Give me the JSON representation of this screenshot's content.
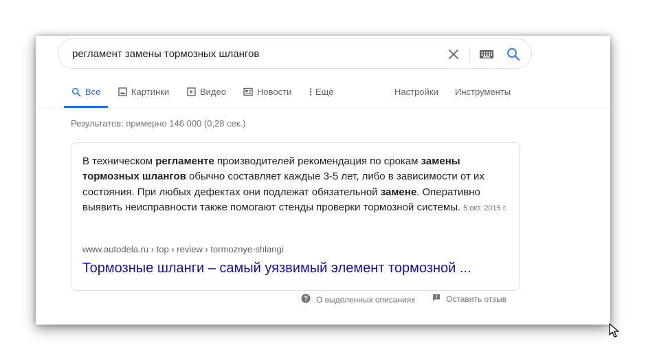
{
  "search": {
    "query": "регламент замены тормозных шлангов"
  },
  "tabs": [
    {
      "label": "Все",
      "icon": "search-icon",
      "active": true
    },
    {
      "label": "Картинки",
      "icon": "image-icon"
    },
    {
      "label": "Видео",
      "icon": "video-icon"
    },
    {
      "label": "Новости",
      "icon": "news-icon"
    },
    {
      "label": "Ещё",
      "icon": "more-vert-icon"
    }
  ],
  "tools": {
    "settings": "Настройки",
    "tools": "Инструменты"
  },
  "stats": "Результатов: примерно 146 000 (0,28 сек.)",
  "snippet": {
    "parts": [
      {
        "text": "В техническом ",
        "bold": false
      },
      {
        "text": "регламенте",
        "bold": true
      },
      {
        "text": " производителей рекомендация по срокам ",
        "bold": false
      },
      {
        "text": "замены тормозных шлангов",
        "bold": true
      },
      {
        "text": " обычно составляет каждые 3-5 лет, либо в зависимости от их состояния. При любых дефектах они подлежат обязательной ",
        "bold": false
      },
      {
        "text": "замене",
        "bold": true
      },
      {
        "text": ". Оперативно выявить неисправности также помогают стенды проверки тормозной системы.",
        "bold": false
      }
    ],
    "date": "5 окт. 2015 г.",
    "breadcrumb": "www.autodela.ru › top › review › tormoznye-shlangi",
    "title": "Тормозные шланги – самый уязвимый элемент тормозной ..."
  },
  "footer": {
    "about": "О выделенных описаниях",
    "feedback": "Оставить отзыв"
  },
  "colors": {
    "accent": "#1a73e8",
    "link": "#1a0dab",
    "text": "#202124",
    "muted": "#70757a"
  }
}
